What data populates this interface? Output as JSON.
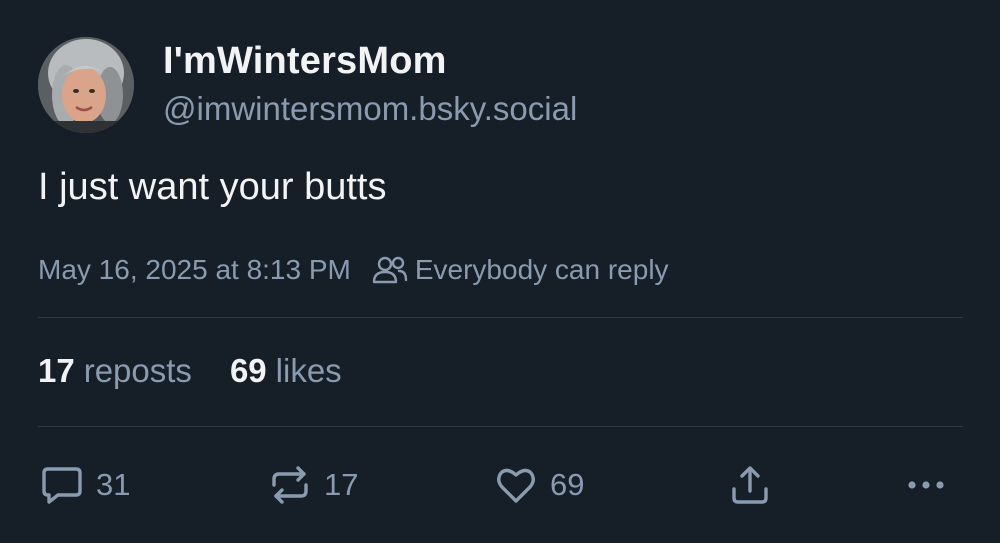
{
  "author": {
    "display_name": "I'mWintersMom",
    "handle": "@imwintersmom.bsky.social"
  },
  "post": {
    "text": "I just want your butts",
    "timestamp": "May 16, 2025 at 8:13 PM",
    "reply_setting": "Everybody can reply"
  },
  "stats": {
    "reposts_count": "17",
    "reposts_label": "reposts",
    "likes_count": "69",
    "likes_label": "likes"
  },
  "actions": {
    "reply_count": "31",
    "repost_count": "17",
    "like_count": "69"
  },
  "icons": {
    "reply": "speech-bubble-icon",
    "repost": "repost-arrows-icon",
    "like": "heart-icon",
    "share": "share-upload-icon",
    "more": "more-dots-icon",
    "reply_setting": "people-icon"
  },
  "colors": {
    "background": "#161e27",
    "text_primary": "#f1f3f5",
    "text_secondary": "#8a9bb0",
    "divider": "#2c3947"
  }
}
